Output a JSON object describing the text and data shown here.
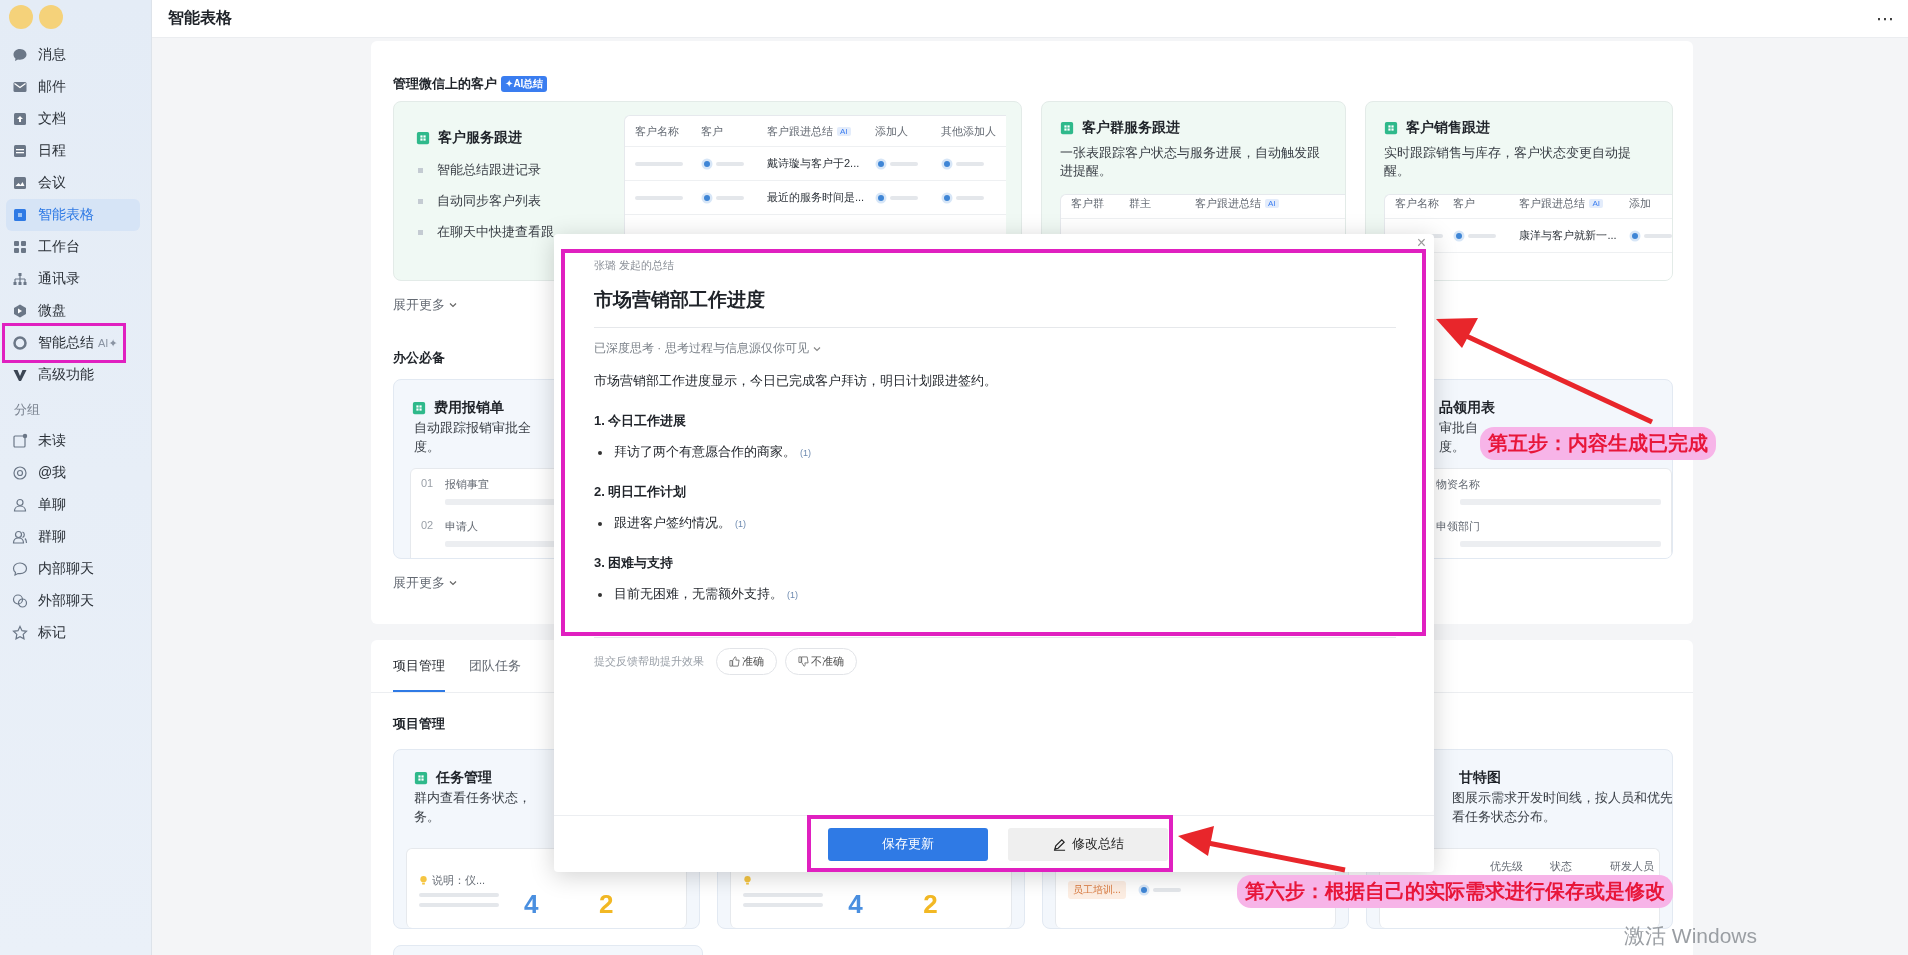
{
  "sidebar": {
    "nav_items": [
      {
        "label": "消息",
        "selected": false
      },
      {
        "label": "邮件",
        "selected": false
      },
      {
        "label": "文档",
        "selected": false
      },
      {
        "label": "日程",
        "selected": false
      },
      {
        "label": "会议",
        "selected": false
      },
      {
        "label": "智能表格",
        "selected": true
      },
      {
        "label": "工作台",
        "selected": false
      },
      {
        "label": "通讯录",
        "selected": false
      },
      {
        "label": "微盘",
        "selected": false
      },
      {
        "label": "智能总结",
        "selected": false,
        "badge": "AI✦"
      },
      {
        "label": "高级功能",
        "selected": false
      }
    ],
    "group_label": "分组",
    "group_items": [
      {
        "label": "未读"
      },
      {
        "label": "@我"
      },
      {
        "label": "单聊"
      },
      {
        "label": "群聊"
      },
      {
        "label": "内部聊天"
      },
      {
        "label": "外部聊天"
      },
      {
        "label": "标记"
      }
    ]
  },
  "header": {
    "title": "智能表格",
    "more": "⋯"
  },
  "wechat_section": {
    "title": "管理微信上的客户",
    "badge": "✦AI总结",
    "main_card": {
      "title": "客户服务跟进",
      "points": [
        "智能总结跟进记录",
        "自动同步客户列表",
        "在聊天中快捷查看跟"
      ],
      "table": {
        "columns": [
          {
            "label": "客户名称"
          },
          {
            "label": "客户"
          },
          {
            "label": "客户跟进总结",
            "tag": "AI"
          },
          {
            "label": "添加人"
          },
          {
            "label": "其他添加人"
          }
        ],
        "rows": [
          [
            {
              "kind": "bar"
            },
            {
              "kind": "avatar"
            },
            {
              "kind": "text",
              "text": "戴诗璇与客户于2..."
            },
            {
              "kind": "avatar"
            },
            {
              "kind": "avatar"
            }
          ],
          [
            {
              "kind": "bar"
            },
            {
              "kind": "avatar"
            },
            {
              "kind": "text",
              "text": "最近的服务时间是..."
            },
            {
              "kind": "avatar"
            },
            {
              "kind": "avatar"
            }
          ]
        ]
      }
    },
    "cards": [
      {
        "title": "客户群服务跟进",
        "desc": "一张表跟踪客户状态与服务进展，自动触发跟进提醒。",
        "table": {
          "columns": [
            {
              "label": "客户群"
            },
            {
              "label": "群主"
            },
            {
              "label": "客户跟进总结",
              "tag": "AI"
            }
          ]
        }
      },
      {
        "title": "客户销售跟进",
        "desc": "实时跟踪销售与库存，客户状态变更自动提醒。",
        "table": {
          "columns": [
            {
              "label": "客户名称"
            },
            {
              "label": "客户"
            },
            {
              "label": "客户跟进总结",
              "tag": "AI"
            },
            {
              "label": "添加"
            }
          ],
          "rows": [
            [
              {
                "kind": "bar"
              },
              {
                "kind": "avatar"
              },
              {
                "kind": "text",
                "text": "康洋与客户就新一..."
              },
              {
                "kind": "avatar"
              }
            ]
          ]
        }
      }
    ],
    "more": "展开更多"
  },
  "office_section": {
    "title": "办公必备",
    "cards": [
      {
        "title": "费用报销单",
        "desc_lines": [
          "自动跟踪报销审批全",
          "度。"
        ],
        "fields": [
          {
            "num": "01",
            "label": "报销事宜"
          },
          {
            "num": "02",
            "label": "申请人"
          }
        ]
      },
      {
        "title": "品领用表",
        "desc_lines": [
          "审批自",
          "度。"
        ],
        "fields": [
          {
            "label": "物资名称"
          },
          {
            "label": "申领部门"
          }
        ]
      }
    ],
    "more": "展开更多"
  },
  "project_section": {
    "tabs": [
      {
        "label": "项目管理",
        "selected": true
      },
      {
        "label": "团队任务",
        "selected": false
      }
    ],
    "title": "项目管理",
    "cards": [
      {
        "kind": "stats",
        "title": "任务管理",
        "desc_lines": [
          "群内查看任务状态，",
          "务。"
        ],
        "note": "说明：仪...",
        "stats": [
          {
            "value": "4",
            "color": "#4a8fe0"
          },
          {
            "value": "2",
            "color": "#f2b824"
          }
        ]
      },
      {
        "kind": "stats",
        "stats": [
          {
            "value": "4",
            "color": "#4a8fe0"
          },
          {
            "value": "2",
            "color": "#f2b824"
          }
        ]
      },
      {
        "kind": "tag",
        "tag": "员工培训..."
      },
      {
        "kind": "gantt",
        "title": "甘特图",
        "desc_lines": [
          "图展示需求开发时间线，按人员和优先",
          "看任务状态分布。"
        ],
        "columns": [
          "优先级",
          "状态",
          "研发人员"
        ]
      }
    ]
  },
  "modal": {
    "close": "×",
    "author_line": "张璐 发起的总结",
    "title": "市场营销部工作进度",
    "thinking": "已深度思考 · 思考过程与信息源仅你可见",
    "summary": "市场营销部工作进度显示，今日已完成客户拜访，明日计划跟进签约。",
    "sections": [
      {
        "heading": "1. 今日工作进展",
        "bullets": [
          {
            "text": "拜访了两个有意愿合作的商家。",
            "ref": "(1)"
          }
        ]
      },
      {
        "heading": "2. 明日工作计划",
        "bullets": [
          {
            "text": "跟进客户签约情况。",
            "ref": "(1)"
          }
        ]
      },
      {
        "heading": "3. 困难与支持",
        "bullets": [
          {
            "text": "目前无困难，无需额外支持。",
            "ref": "(1)"
          }
        ]
      }
    ],
    "feedback": {
      "prompt": "提交反馈帮助提升效果",
      "good": "准确",
      "bad": "不准确"
    },
    "actions": [
      {
        "kind": "primary",
        "label": "保存更新"
      },
      {
        "kind": "edit",
        "label": "修改总结"
      }
    ]
  },
  "callouts": [
    "第五步：内容生成已完成",
    "第六步：根据自己的实际需求进行保存或是修改"
  ],
  "os_notice": "激活 Windows"
}
